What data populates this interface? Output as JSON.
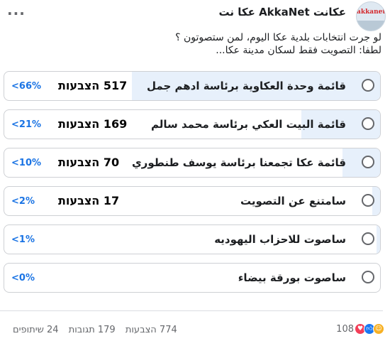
{
  "header": {
    "page_name": "عكانت AkkaNet عكا نت",
    "avatar_text": "akkanet",
    "more_label": "..."
  },
  "post": {
    "line1": "لو جرت انتخابات بلدية عكا اليوم، لمن ستصوتون ؟",
    "line2": "لطفا: التصويت فقط لسكان مدينة عكا..."
  },
  "poll": {
    "options": [
      {
        "label": "قائمة وحدة العكاوية برئاسة ادهم جمل",
        "votes": "517 הצבעות",
        "percent": "66%",
        "percent_value": 66
      },
      {
        "label": "قائمة البيت العكي برئاسة محمد سالم",
        "votes": "169 הצבעות",
        "percent": "21%",
        "percent_value": 21
      },
      {
        "label": "قائمة عكا تجمعنا برئاسة يوسف طنطوري",
        "votes": "70 הצבעות",
        "percent": "10%",
        "percent_value": 10
      },
      {
        "label": "سامتنع عن التصويت",
        "votes": "17 הצבעות",
        "percent": "2%",
        "percent_value": 2
      },
      {
        "label": "ساصوت للاحزاب اليهوديه",
        "votes": "",
        "percent": "1%",
        "percent_value": 1
      },
      {
        "label": "ساصوت بورقة بيضاء",
        "votes": "",
        "percent": "0%",
        "percent_value": 0
      }
    ]
  },
  "footer": {
    "reaction_count": "108",
    "reactions": [
      "like-icon",
      "care-icon",
      "heart-icon"
    ],
    "votes_total": "774 הצבעות",
    "comments": "179 תגובות",
    "shares": "24 שיתופים"
  },
  "colors": {
    "fill": "#e7f0fb",
    "percent": "#1b74e4",
    "border": "#ced0d4"
  }
}
